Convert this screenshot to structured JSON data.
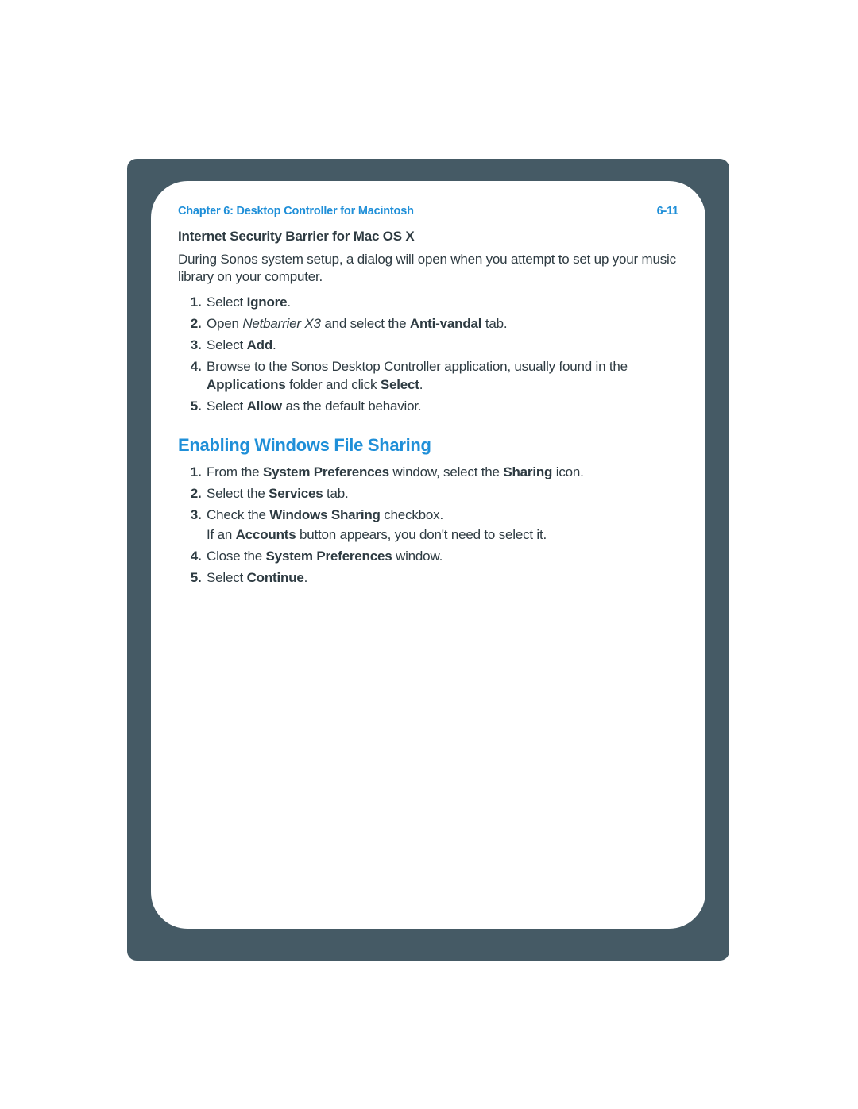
{
  "header": {
    "chapter": "Chapter 6:  Desktop Controller for Macintosh",
    "page": "6-11"
  },
  "section1": {
    "title": "Internet Security Barrier for Mac OS X",
    "intro": "During Sonos system setup, a dialog will open when you attempt to set up your music library on your computer.",
    "steps": [
      {
        "pre": "Select ",
        "b1": "Ignore",
        "post": "."
      },
      {
        "pre": "Open ",
        "i1": "Netbarrier X3",
        "mid": " and select the ",
        "b1": "Anti-vandal",
        "post": " tab."
      },
      {
        "pre": "Select ",
        "b1": "Add",
        "post": "."
      },
      {
        "pre": "Browse to the Sonos Desktop Controller application, usually found in the ",
        "b1": "Applications",
        "mid": " folder and click ",
        "b2": "Select",
        "post": "."
      },
      {
        "pre": "Select ",
        "b1": "Allow",
        "post": " as the default behavior."
      }
    ]
  },
  "section2": {
    "title": "Enabling Windows File Sharing",
    "steps": [
      {
        "pre": "From the ",
        "b1": "System Preferences",
        "mid": " window, select the ",
        "b2": "Sharing",
        "post": " icon."
      },
      {
        "pre": "Select the ",
        "b1": "Services",
        "post": " tab."
      },
      {
        "pre": "Check the ",
        "b1": "Windows Sharing",
        "post": " checkbox.",
        "sub_pre": "If an ",
        "sub_b1": "Accounts",
        "sub_post": " button appears, you don't need to select it."
      },
      {
        "pre": "Close the ",
        "b1": "System Preferences",
        "post": " window."
      },
      {
        "pre": "Select ",
        "b1": "Continue",
        "post": "."
      }
    ]
  }
}
